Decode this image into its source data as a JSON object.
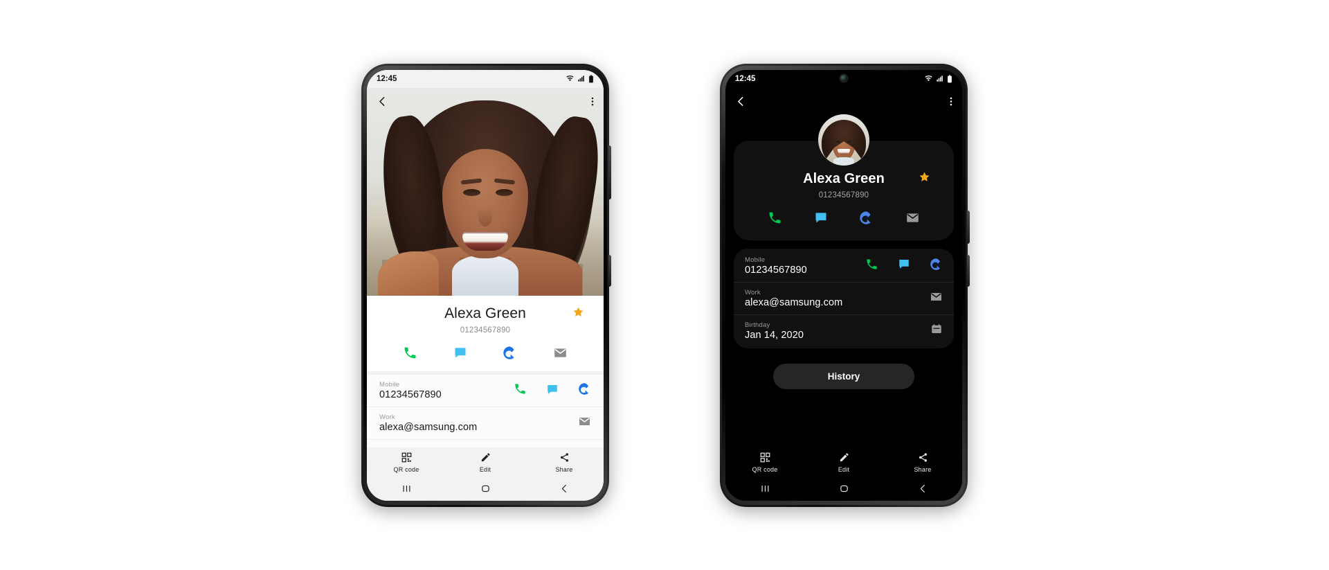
{
  "status_bar": {
    "time": "12:45",
    "icons": [
      "wifi-icon",
      "signal-icon",
      "battery-icon"
    ]
  },
  "app_bar": {
    "back": "back-arrow-icon",
    "more": "more-options-icon"
  },
  "contact": {
    "name": "Alexa Green",
    "phone_display": "01234567890",
    "favorite": true,
    "quick_actions": [
      {
        "name": "call",
        "icon": "phone-icon",
        "color": "#00C853"
      },
      {
        "name": "message",
        "icon": "message-icon",
        "color": "#3FC0F0"
      },
      {
        "name": "video-call",
        "icon": "duo-video-icon",
        "color": "#1A73E8"
      },
      {
        "name": "email",
        "icon": "email-icon",
        "color": "#8C8C8C"
      }
    ],
    "details": [
      {
        "label": "Mobile",
        "value": "01234567890",
        "actions": [
          "phone-icon",
          "message-icon",
          "duo-video-icon"
        ]
      },
      {
        "label": "Work",
        "value": "alexa@samsung.com",
        "actions": [
          "email-icon"
        ]
      },
      {
        "label": "Birthday",
        "value": "Jan 14, 2020",
        "actions": [
          "calendar-icon"
        ]
      }
    ],
    "history_button": "History"
  },
  "bottom_bar": [
    {
      "label": "QR code",
      "icon": "qr-code-icon"
    },
    {
      "label": "Edit",
      "icon": "pencil-edit-icon"
    },
    {
      "label": "Share",
      "icon": "share-icon"
    }
  ],
  "nav_bar": [
    "recents-icon",
    "home-icon",
    "back-icon"
  ],
  "themes": {
    "light": {
      "screen_bg": "#FAFAFA",
      "card_bg": "#FFFFFF",
      "text": "#1A1A1A",
      "label": "#999999"
    },
    "dark": {
      "screen_bg": "#000000",
      "card_bg": "#111111",
      "text": "#FFFFFF",
      "label": "#9A9A9A",
      "button_bg": "#262626"
    },
    "star_color": "#F0A81E"
  }
}
